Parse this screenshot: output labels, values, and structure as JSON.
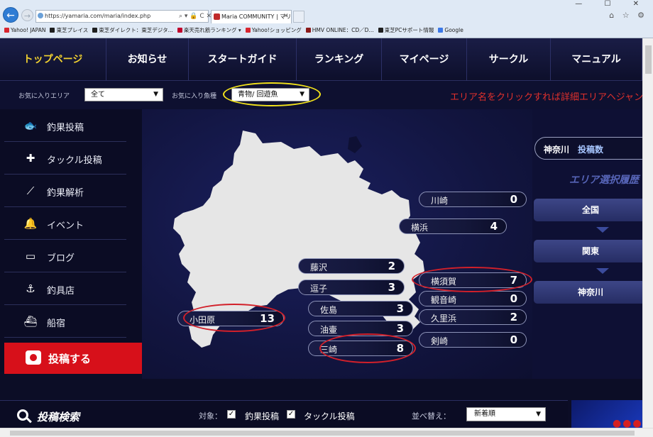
{
  "browser": {
    "url": "https://yamaria.com/maria/index.php",
    "address_tools": "⌕ ▾ 🔒 C ✕",
    "tab_title": "Maria COMMUNITY | マリ...",
    "tab_close": "✕",
    "right_tools": "⌂ ☆ ⚙",
    "window_buttons": "— ☐ ✕",
    "favorites": [
      {
        "label": "Yahoo! JAPAN",
        "color": "#d8262f"
      },
      {
        "label": "東芝プレイス",
        "color": "#1f1f1f"
      },
      {
        "label": "東芝ダイレクト：東芝デジタ...",
        "color": "#1f1f1f"
      },
      {
        "label": "楽天売れ筋ランキング ▾",
        "color": "#c0002b"
      },
      {
        "label": "Yahoo!ショッピング",
        "color": "#d8262f"
      },
      {
        "label": "HMV ONLINE：CD／D...",
        "color": "#8b1a1a"
      },
      {
        "label": "東芝PCサポート情報",
        "color": "#1f1f1f"
      },
      {
        "label": "Google",
        "color": "#3b78e7"
      }
    ]
  },
  "nav": {
    "items": [
      "トップページ",
      "お知らせ",
      "スタートガイド",
      "ランキング",
      "マイページ",
      "サークル",
      "マニュアル"
    ],
    "active_index": 0,
    "active_color": "#f2d230"
  },
  "filters": {
    "area_label": "お気に入りエリア",
    "area_value": "全て",
    "fish_label": "お気に入り魚種",
    "fish_value": "青物/ 回遊魚",
    "arrow": "▼",
    "notice": "エリア名をクリックすれば詳細エリアヘジャンプ"
  },
  "sidebar": {
    "items": [
      {
        "label": "釣果投稿",
        "icon": "fish-icon",
        "glyph": "🐟"
      },
      {
        "label": "タックル投稿",
        "icon": "tackle-icon",
        "glyph": "✚"
      },
      {
        "label": "釣果解析",
        "icon": "analysis-icon",
        "glyph": "⟋"
      },
      {
        "label": "イベント",
        "icon": "bell-icon",
        "glyph": "🔔"
      },
      {
        "label": "ブログ",
        "icon": "speech-bubble-icon",
        "glyph": "▭"
      },
      {
        "label": "釣具店",
        "icon": "hook-icon",
        "glyph": "⚓"
      },
      {
        "label": "船宿",
        "icon": "boat-icon",
        "glyph": "⛴"
      }
    ],
    "post_label": "投稿する"
  },
  "map": {
    "areas": [
      {
        "name": "川崎",
        "count": "0"
      },
      {
        "name": "横浜",
        "count": "4"
      },
      {
        "name": "藤沢",
        "count": "2"
      },
      {
        "name": "逗子",
        "count": "3"
      },
      {
        "name": "横須賀",
        "count": "7"
      },
      {
        "name": "観音崎",
        "count": "0"
      },
      {
        "name": "佐島",
        "count": "3"
      },
      {
        "name": "久里浜",
        "count": "2"
      },
      {
        "name": "小田原",
        "count": "13"
      },
      {
        "name": "油壷",
        "count": "3"
      },
      {
        "name": "三崎",
        "count": "8"
      },
      {
        "name": "剣崎",
        "count": "0"
      }
    ]
  },
  "right_panel": {
    "prefecture": "神奈川",
    "posts_label": "投稿数",
    "history_title": "エリア選択履歴",
    "history": [
      "全国",
      "関東",
      "神奈川"
    ]
  },
  "search": {
    "title": "投稿検索",
    "target_label": "対象：",
    "check_mark": "✓",
    "option_catch": "釣果投稿",
    "option_tackle": "タックル投稿",
    "sort_label": "並べ替え：",
    "sort_value": "新着順",
    "arrow": "▼"
  }
}
